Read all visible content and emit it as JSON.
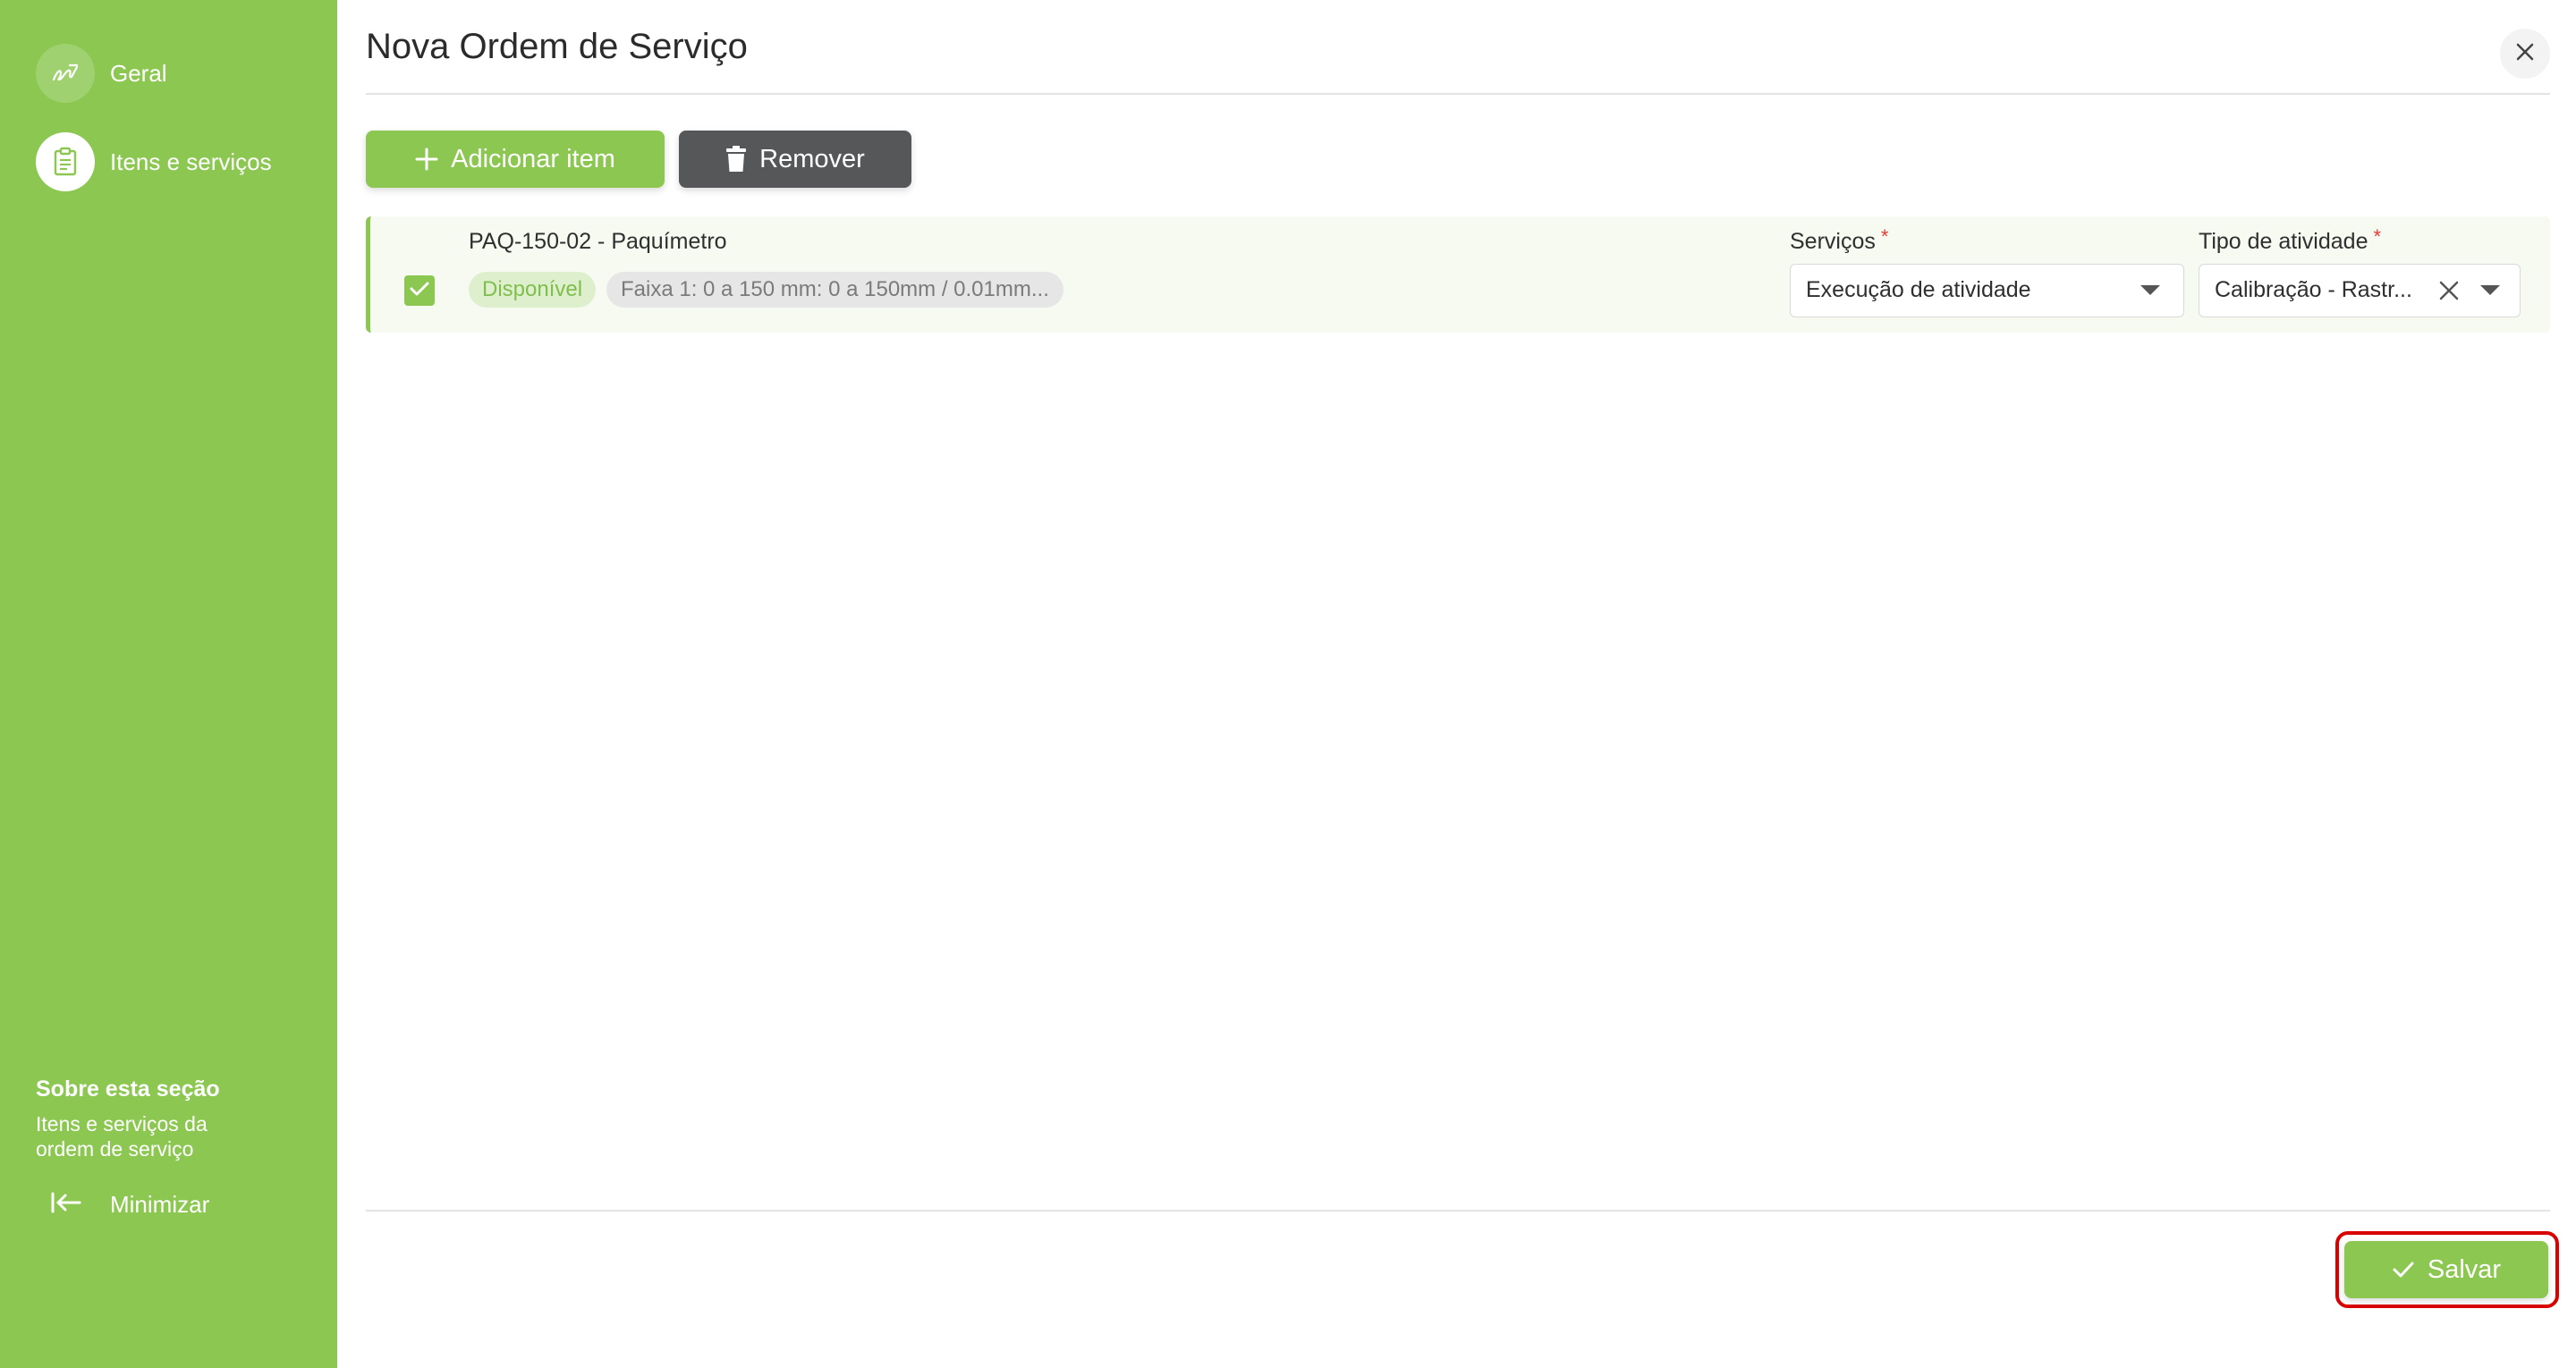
{
  "sidebar": {
    "items": [
      {
        "label": "Geral",
        "icon": "signature-icon",
        "active": false
      },
      {
        "label": "Itens e serviços",
        "icon": "clipboard-icon",
        "active": true
      }
    ],
    "about_title": "Sobre esta seção",
    "about_description_line1": "Itens e serviços da",
    "about_description_line2": "ordem de serviço",
    "minimize_label": "Minimizar"
  },
  "header": {
    "title": "Nova Ordem de Serviço"
  },
  "toolbar": {
    "add_label": "Adicionar item",
    "remove_label": "Remover"
  },
  "items": [
    {
      "name": "PAQ-150-02 - Paquímetro",
      "checked": true,
      "status": "Disponível",
      "range": "Faixa 1: 0 a 150 mm: 0 a 150mm / 0.01mm...",
      "servicos_label": "Serviços",
      "servicos_value": "Execução de atividade",
      "tipo_label": "Tipo de atividade",
      "tipo_value": "Calibração - Rastr...",
      "required_mark": "*"
    }
  ],
  "footer": {
    "save_label": "Salvar"
  },
  "colors": {
    "accent": "#8bc751",
    "dark_button": "#555759",
    "required": "#e53935",
    "highlight": "#d90000"
  }
}
